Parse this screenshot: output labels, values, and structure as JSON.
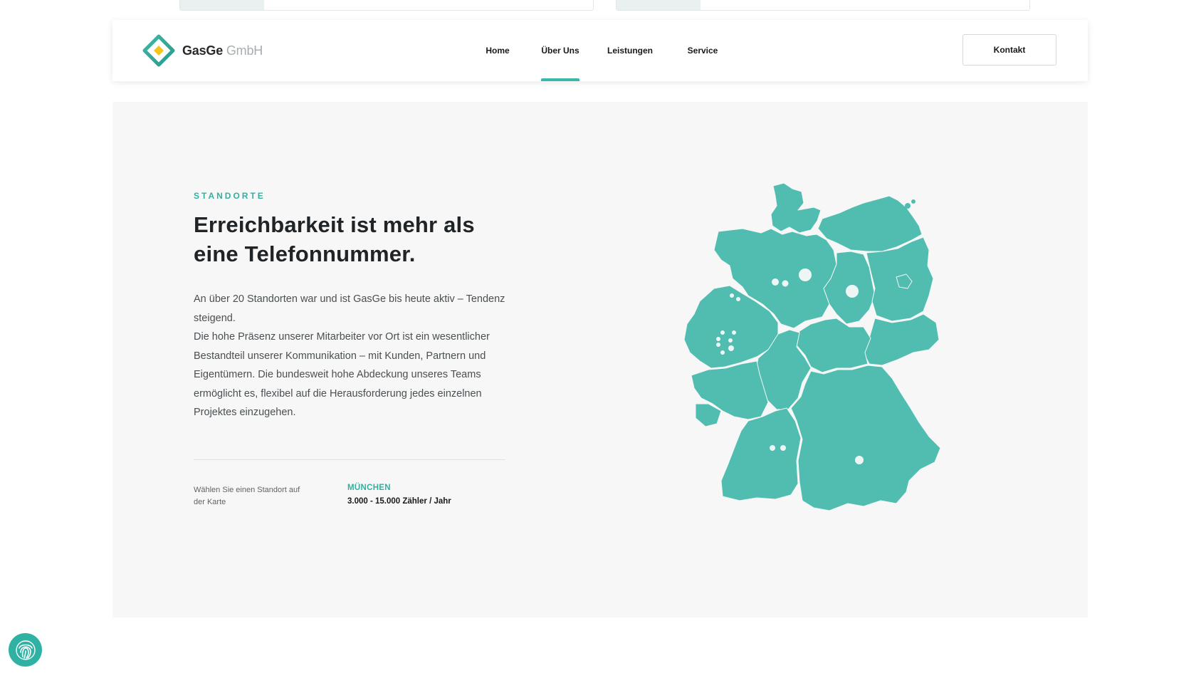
{
  "brand": {
    "name_bold": "GasGe",
    "name_light": "GmbH",
    "accent_color": "#2fb2a4",
    "logo_icon": "diamond-logo-icon"
  },
  "nav": {
    "items": [
      {
        "label": "Home",
        "active": false
      },
      {
        "label": "Über Uns",
        "active": true
      },
      {
        "label": "Leistungen",
        "active": false
      },
      {
        "label": "Service",
        "active": false
      }
    ],
    "contact_label": "Kontakt"
  },
  "section": {
    "eyebrow": "STANDORTE",
    "headline": "Erreichbarkeit ist mehr als eine Telefonnummer.",
    "body_line1": "An über 20 Standorten war und ist GasGe bis heute aktiv – Tendenz steigend.",
    "body_line2": "Die hohe Präsenz unserer Mitarbeiter vor Ort ist ein wesentlicher Bestandteil unserer Kommunikation – mit Kunden, Partnern und Eigentümern. Die bundesweit hohe Abdeckung unseres Teams ermöglicht es, flexibel auf die Herausforderung jedes einzelnen Projektes einzugehen."
  },
  "location": {
    "hint": "Wählen Sie einen Standort auf der Karte",
    "selected_city": "MÜNCHEN",
    "selected_detail": "3.000 - 15.000 Zähler / Jahr"
  },
  "map": {
    "fill_color": "#51bdb1",
    "border_color": "#f4f7f6",
    "marker_color": "#eef6f5",
    "marker_count": 15
  },
  "floating": {
    "icon": "fingerprint-icon"
  }
}
